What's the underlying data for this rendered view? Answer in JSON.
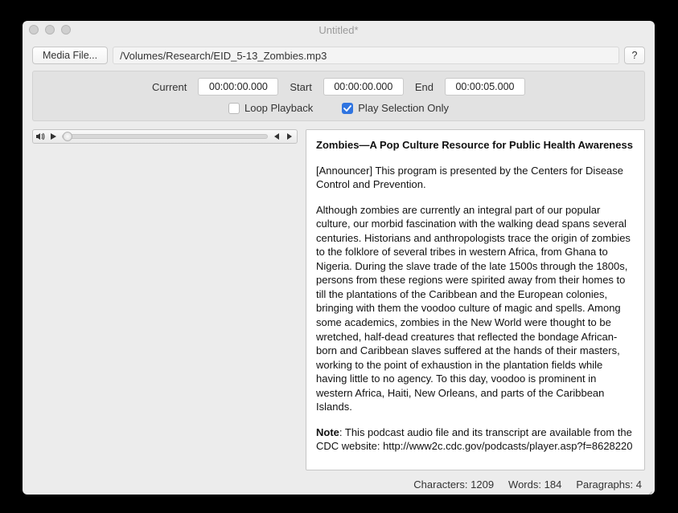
{
  "window": {
    "title": "Untitled*"
  },
  "toolbar": {
    "media_button": "Media File...",
    "path": "/Volumes/Research/EID_5-13_Zombies.mp3",
    "help": "?"
  },
  "time": {
    "current_label": "Current",
    "current_value": "00:00:00.000",
    "start_label": "Start",
    "start_value": "00:00:00.000",
    "end_label": "End",
    "end_value": "00:00:05.000"
  },
  "options": {
    "loop_label": "Loop Playback",
    "loop_checked": false,
    "playsel_label": "Play Selection Only",
    "playsel_checked": true
  },
  "icons": {
    "mute": "mute-icon",
    "play": "play-icon",
    "prev": "prev-icon",
    "next": "next-icon"
  },
  "transcript": {
    "heading": "Zombies—A Pop Culture Resource for Public Health Awareness",
    "p1": "[Announcer] This program is presented by the Centers for Disease Control and Prevention.",
    "p2": "Although zombies are currently an integral part of our popular culture, our morbid fascination with the walking dead spans several centuries. Historians and anthropologists trace the origin of zombies to the folklore of several tribes in western Africa, from Ghana to Nigeria. During the slave trade of the late 1500s through the 1800s, persons from these regions were spirited away from their homes to till the plantations of the Caribbean and the European colonies, bringing with them the voodoo culture of magic and spells. Among some academics, zombies in the New World were thought to be wretched, half-dead creatures that reflected the bondage African-born and Caribbean slaves suffered at the hands of their masters, working to the point of exhaustion in the plantation fields while having little to no agency. To this day, voodoo is prominent in western Africa, Haiti, New Orleans, and parts of the Caribbean Islands.",
    "note_label": "Note",
    "note_body": ": This podcast audio file and its transcript are available from the CDC website: http://www2c.cdc.gov/podcasts/player.asp?f=8628220"
  },
  "status": {
    "chars_label": "Characters:",
    "chars": "1209",
    "words_label": "Words:",
    "words": "184",
    "paras_label": "Paragraphs:",
    "paras": "4"
  }
}
